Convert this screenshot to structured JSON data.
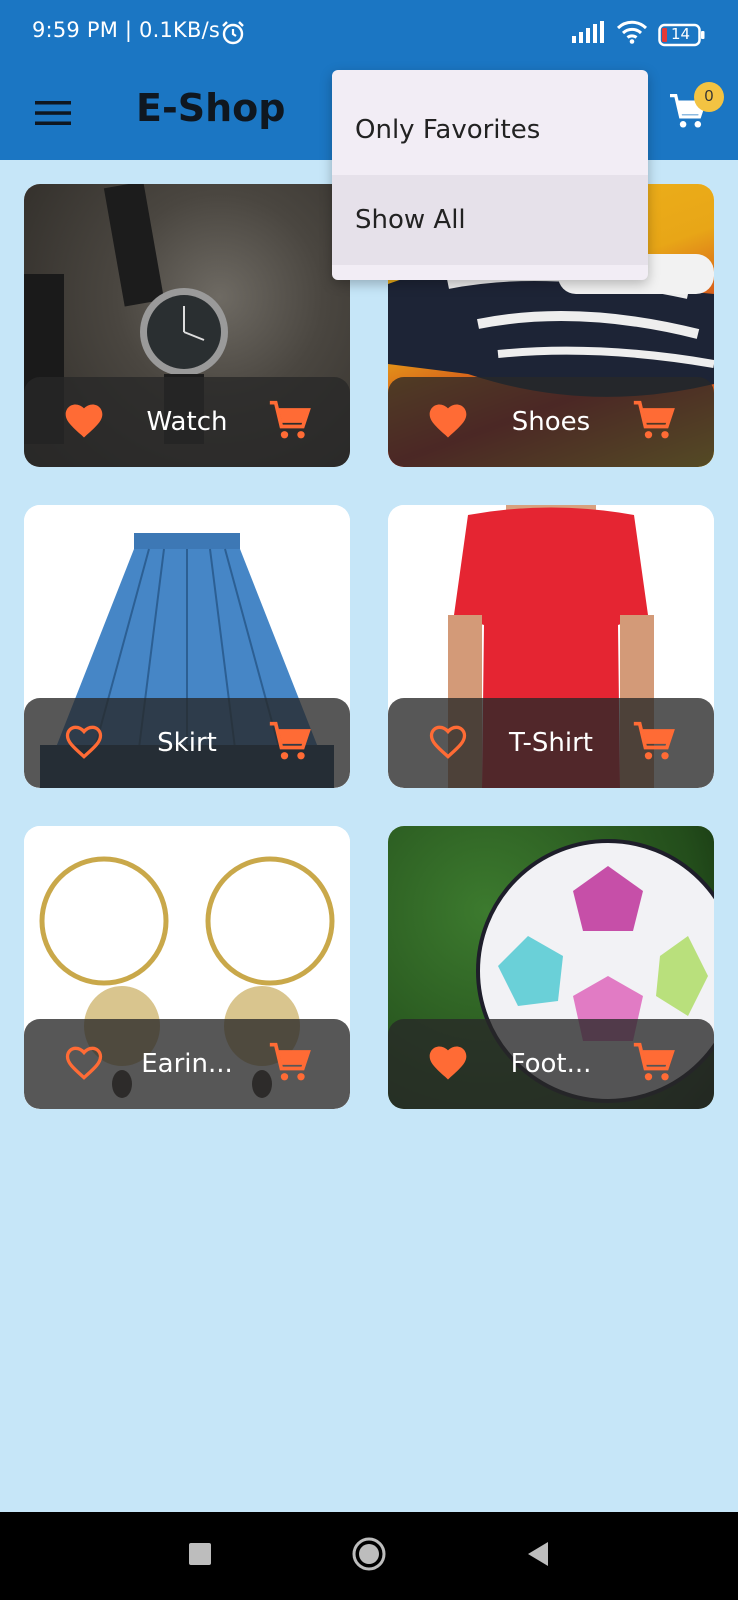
{
  "status": {
    "time_speed": "9:59 PM | 0.1KB/s",
    "battery": "14"
  },
  "appbar": {
    "title": "E-Shop",
    "cart_count": "0"
  },
  "dropdown": {
    "items": [
      {
        "label": "Only Favorites"
      },
      {
        "label": "Show All"
      }
    ]
  },
  "products": [
    {
      "title": "Watch",
      "favorite": true
    },
    {
      "title": "Shoes",
      "favorite": true
    },
    {
      "title": "Skirt",
      "favorite": false
    },
    {
      "title": "T-Shirt",
      "favorite": false
    },
    {
      "title": "Earin...",
      "favorite": false
    },
    {
      "title": "Foot...",
      "favorite": true
    }
  ],
  "colors": {
    "appbar": "#1b76c3",
    "background": "#c6e6f8",
    "accent": "#ff6b35",
    "badge": "#f3c342"
  }
}
